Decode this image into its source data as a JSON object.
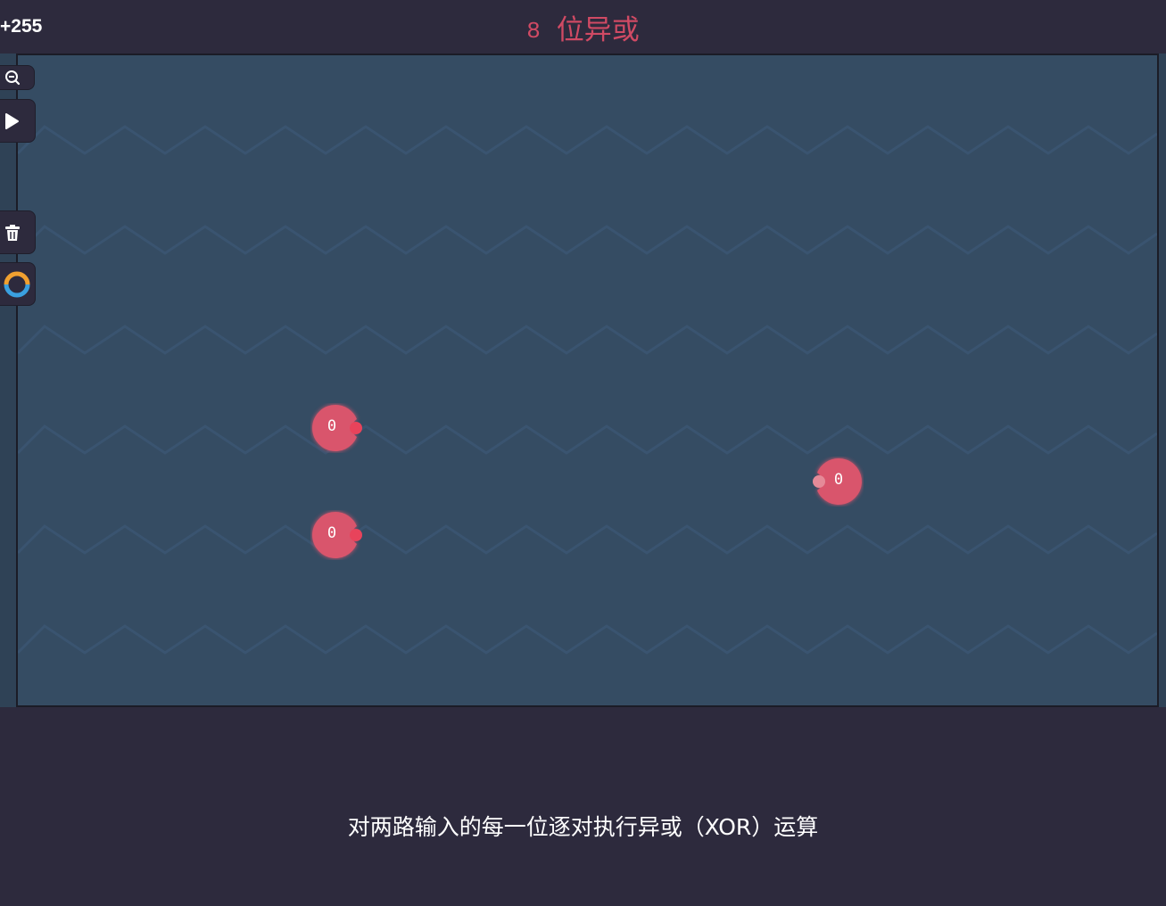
{
  "header": {
    "score": "+255",
    "level_number": "8",
    "level_title": "位异或"
  },
  "toolbar": {
    "items": [
      {
        "name": "zoom-out-button",
        "icon": "zoom-out-icon"
      },
      {
        "name": "play-button",
        "icon": "play-icon"
      },
      {
        "name": "delete-button",
        "icon": "trash-icon"
      },
      {
        "name": "theme-toggle-button",
        "icon": "ring-icon"
      }
    ]
  },
  "board": {
    "inputs": [
      {
        "value": "0"
      },
      {
        "value": "0"
      }
    ],
    "outputs": [
      {
        "value": "0"
      }
    ]
  },
  "description": "对两路输入的每一位逐对执行异或（XOR）运算",
  "colors": {
    "background": "#2d2a3d",
    "board": "#354c63",
    "wave": "#3a5470",
    "accent": "#d04a64",
    "node": "#d9546c",
    "pin": "#e8435b",
    "icon_orange": "#f0a030",
    "icon_blue": "#3aa0e0"
  }
}
